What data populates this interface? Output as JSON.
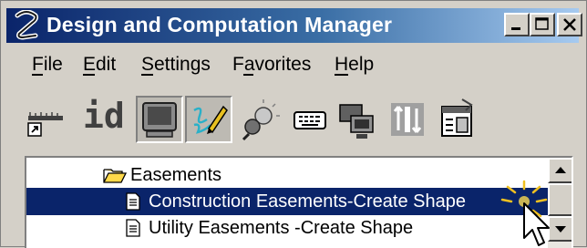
{
  "window": {
    "title": "Design and Computation Manager",
    "controls": [
      "minimize",
      "maximize",
      "close"
    ]
  },
  "menu": {
    "items": [
      {
        "label": "File",
        "mnemonic": "F"
      },
      {
        "label": "Edit",
        "mnemonic": "E"
      },
      {
        "label": "Settings",
        "mnemonic": "S"
      },
      {
        "label": "Favorites",
        "mnemonic": "a"
      },
      {
        "label": "Help",
        "mnemonic": "H"
      }
    ]
  },
  "toolbar": {
    "id_label": "id",
    "tools": [
      {
        "icon": "dimension-ruler-icon",
        "pressed": false
      },
      {
        "icon": "id-icon",
        "pressed": false
      },
      {
        "icon": "monitor-icon",
        "pressed": true
      },
      {
        "icon": "draw-pencil-icon",
        "pressed": true
      },
      {
        "icon": "lightbulb-icon",
        "pressed": false
      },
      {
        "icon": "keyboard-icon",
        "pressed": false
      },
      {
        "icon": "monitor-network-icon",
        "pressed": false
      },
      {
        "icon": "sort-icon",
        "pressed": false
      },
      {
        "icon": "properties-icon",
        "pressed": false
      }
    ]
  },
  "tree": {
    "items": [
      {
        "label": "Easements",
        "type": "folder",
        "selected": false
      },
      {
        "label": "Construction  Easements-Create Shape",
        "type": "document",
        "selected": true
      },
      {
        "label": "Utility  Easements -Create Shape",
        "type": "document",
        "selected": false
      }
    ]
  },
  "colors": {
    "face": "#d4d0c8",
    "title_start": "#0a246a",
    "title_end": "#a6caf0",
    "selection": "#0a246a"
  }
}
